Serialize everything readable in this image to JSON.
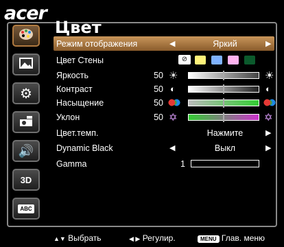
{
  "brand": "acer",
  "title": "Цвет",
  "menu": {
    "display_mode": {
      "label": "Режим отображения",
      "value": "Яркий"
    },
    "wall_color": {
      "label": "Цвет Стены",
      "colors": [
        "#fff27a",
        "#7fb2ff",
        "#ffb3ef",
        "#0b5a2c"
      ]
    },
    "brightness": {
      "label": "Яркость",
      "value": "50",
      "fill": 0.5
    },
    "contrast": {
      "label": "Контраст",
      "value": "50",
      "fill": 0.5
    },
    "saturation": {
      "label": "Насыщение",
      "value": "50",
      "fill": 0.5
    },
    "tint": {
      "label": "Уклон",
      "value": "50",
      "fill": 0.5
    },
    "color_temp": {
      "label": "Цвет.темп.",
      "value": "Нажмите"
    },
    "dynamic_black": {
      "label": "Dynamic Black",
      "value": "Выкл"
    },
    "gamma": {
      "label": "Gamma",
      "value": "1"
    }
  },
  "footer": {
    "select": "Выбрать",
    "adjust": "Регулир.",
    "menu_key": "MENU",
    "main_menu": "Глав. меню"
  },
  "icons": [
    "palette-icon",
    "image-icon",
    "gear-icon",
    "projector-icon",
    "speaker-icon",
    "3d-icon",
    "abc-language-icon"
  ]
}
